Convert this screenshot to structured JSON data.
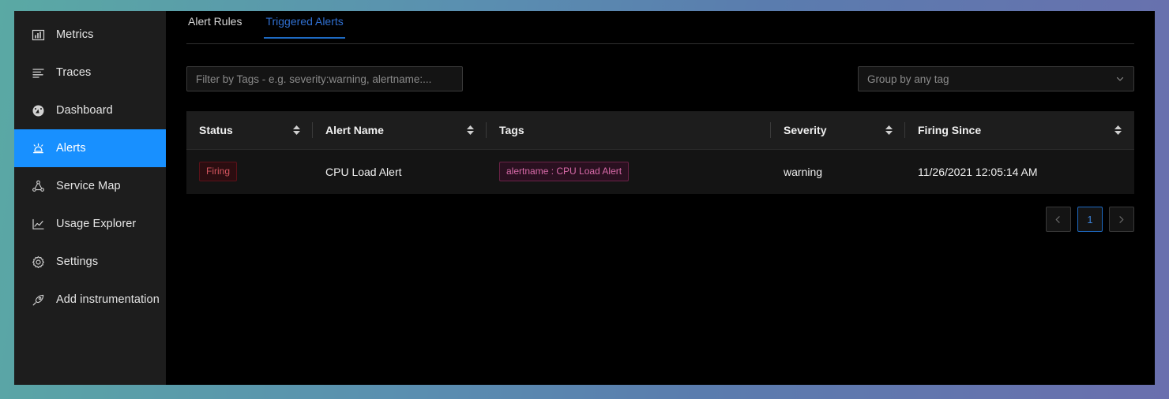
{
  "theme": {
    "accent_blue": "#1890ff",
    "tab_active_blue": "#2f6fd0",
    "firing_red": "#d4565f",
    "tag_pink": "#d86aa8",
    "page_bg_gradient_from": "#5aa9a4",
    "page_bg_gradient_to": "#6a6fae",
    "sidebar_bg": "#1d1d1d",
    "table_header_bg": "#1d1d1d",
    "table_row_bg": "#141414"
  },
  "sidebar": {
    "items": [
      {
        "label": "Metrics",
        "icon": "bar-chart-icon",
        "active": false
      },
      {
        "label": "Traces",
        "icon": "list-lines-icon",
        "active": false
      },
      {
        "label": "Dashboard",
        "icon": "dashboard-gauge-icon",
        "active": false
      },
      {
        "label": "Alerts",
        "icon": "alarm-light-icon",
        "active": true
      },
      {
        "label": "Service Map",
        "icon": "node-network-icon",
        "active": false
      },
      {
        "label": "Usage Explorer",
        "icon": "line-chart-icon",
        "active": false
      },
      {
        "label": "Settings",
        "icon": "gear-icon",
        "active": false
      },
      {
        "label": "Add instrumentation",
        "icon": "rocket-icon",
        "active": false
      }
    ]
  },
  "tabs": [
    {
      "label": "Alert Rules",
      "active": false
    },
    {
      "label": "Triggered Alerts",
      "active": true
    }
  ],
  "filters": {
    "tag_filter": {
      "value": "",
      "placeholder": "Filter by Tags - e.g. severity:warning, alertname:..."
    },
    "group_by": {
      "value": "Group by any tag",
      "caret_icon": "chevron-down-icon"
    }
  },
  "table": {
    "columns": [
      {
        "label": "Status",
        "sortable": true
      },
      {
        "label": "Alert Name",
        "sortable": true
      },
      {
        "label": "Tags",
        "sortable": false
      },
      {
        "label": "Severity",
        "sortable": true
      },
      {
        "label": "Firing Since",
        "sortable": true
      }
    ],
    "rows": [
      {
        "status": "Firing",
        "alert_name": "CPU Load Alert",
        "tag": "alertname : CPU Load Alert",
        "severity": "warning",
        "firing_since": "11/26/2021 12:05:14 AM"
      }
    ]
  },
  "pagination": {
    "prev_icon": "chevron-left-icon",
    "next_icon": "chevron-right-icon",
    "current_page": "1"
  }
}
